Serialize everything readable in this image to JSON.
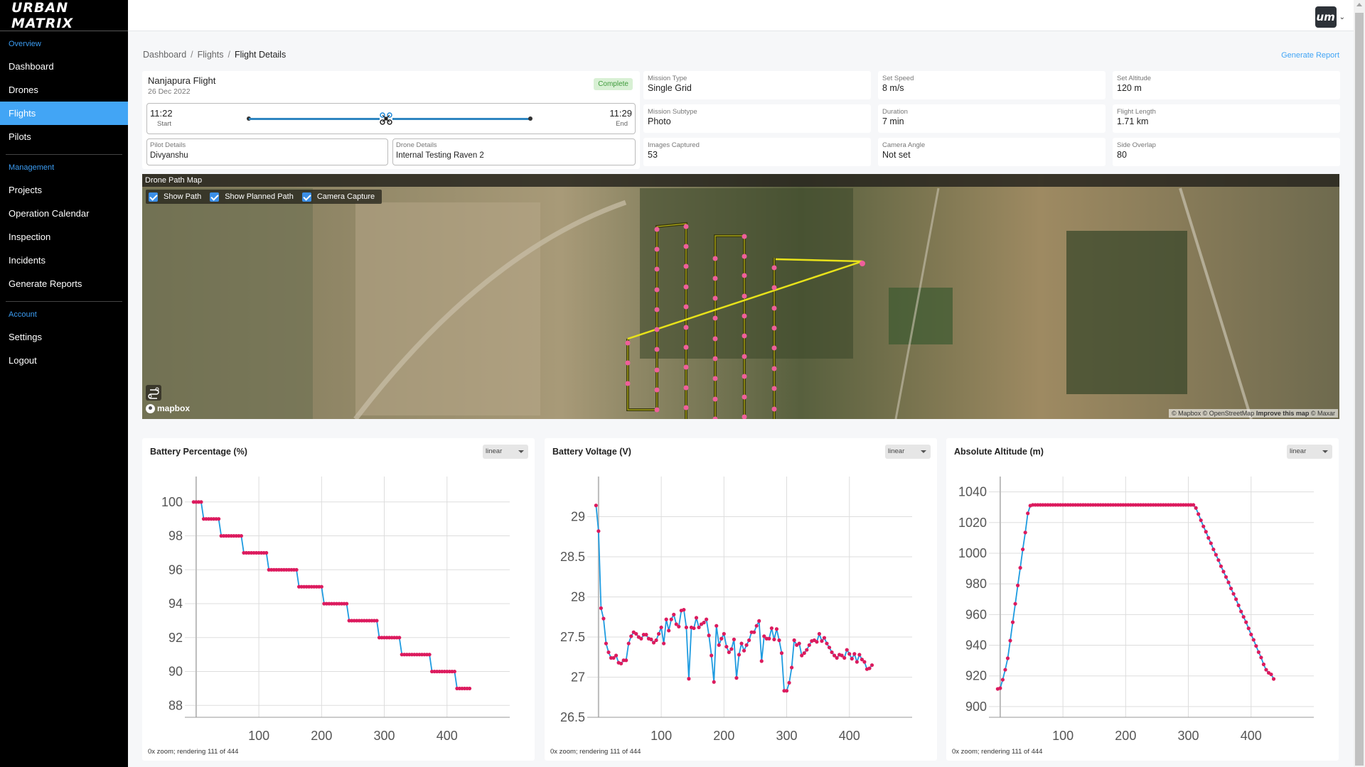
{
  "app": {
    "logo_text": "URBAN MATRIX",
    "avatar_text": "um"
  },
  "sidebar": {
    "sections": [
      {
        "title": "Overview",
        "items": [
          "Dashboard",
          "Drones",
          "Flights",
          "Pilots"
        ]
      },
      {
        "title": "Management",
        "items": [
          "Projects",
          "Operation Calendar",
          "Inspection",
          "Incidents",
          "Generate Reports"
        ]
      },
      {
        "title": "Account",
        "items": [
          "Settings",
          "Logout"
        ]
      }
    ],
    "active_item": "Flights"
  },
  "breadcrumb": {
    "items": [
      "Dashboard",
      "Flights"
    ],
    "current": "Flight Details",
    "separator": "/"
  },
  "generate_report_label": "Generate Report",
  "flight": {
    "name": "Nanjapura Flight",
    "date": "26 Dec 2022",
    "status": "Complete",
    "start_time": "11:22",
    "start_label": "Start",
    "end_time": "11:29",
    "end_label": "End",
    "pilot_label": "Pilot Details",
    "pilot": "Divyanshu",
    "drone_label": "Drone Details",
    "drone": "Internal Testing Raven 2"
  },
  "stats": [
    {
      "label": "Mission Type",
      "value": "Single Grid"
    },
    {
      "label": "Set Speed",
      "value": "8 m/s"
    },
    {
      "label": "Set Altitude",
      "value": "120 m"
    },
    {
      "label": "Mission Subtype",
      "value": "Photo"
    },
    {
      "label": "Duration",
      "value": "7 min"
    },
    {
      "label": "Flight Length",
      "value": "1.71 km"
    },
    {
      "label": "Images Captured",
      "value": "53"
    },
    {
      "label": "Camera Angle",
      "value": "Not set"
    },
    {
      "label": "Side Overlap",
      "value": "80"
    }
  ],
  "map": {
    "title": "Drone Path Map",
    "controls": [
      {
        "label": "Show Path",
        "checked": true
      },
      {
        "label": "Show Planned Path",
        "checked": true
      },
      {
        "label": "Camera Capture",
        "checked": true
      }
    ],
    "logo": "mapbox",
    "attribution": {
      "mapbox": "© Mapbox",
      "osm": "© OpenStreetMap",
      "improve": "Improve this map",
      "maxar": "© Maxar"
    },
    "colors": {
      "flown_path": "#e8e21a",
      "planned_path": "#3a3a10",
      "capture_point": "#ef5f9b"
    }
  },
  "chart_footer": "0x zoom; rendering 111 of 444",
  "chart_data": [
    {
      "type": "line",
      "title": "Battery Percentage (%)",
      "scale_option": "linear",
      "xlabel": "",
      "ylabel": "",
      "xlim": [
        -18,
        500
      ],
      "ylim": [
        87.3,
        101.5
      ],
      "xticks": [
        100,
        200,
        300,
        400
      ],
      "yticks": [
        88,
        90,
        92,
        94,
        96,
        98,
        100
      ],
      "grid": true,
      "colors": {
        "line": "#1e9be0",
        "marker": "#dc1b5e"
      },
      "steps": [
        {
          "value": 100,
          "x_from": -4,
          "x_to": 8
        },
        {
          "value": 99,
          "x_from": 12,
          "x_to": 36
        },
        {
          "value": 98,
          "x_from": 40,
          "x_to": 72
        },
        {
          "value": 97,
          "x_from": 76,
          "x_to": 112
        },
        {
          "value": 96,
          "x_from": 116,
          "x_to": 160
        },
        {
          "value": 95,
          "x_from": 164,
          "x_to": 200
        },
        {
          "value": 94,
          "x_from": 204,
          "x_to": 240
        },
        {
          "value": 93,
          "x_from": 244,
          "x_to": 288
        },
        {
          "value": 92,
          "x_from": 292,
          "x_to": 324
        },
        {
          "value": 91,
          "x_from": 328,
          "x_to": 372
        },
        {
          "value": 90,
          "x_from": 376,
          "x_to": 412
        },
        {
          "value": 89,
          "x_from": 416,
          "x_to": 436
        }
      ],
      "sample_step": 4
    },
    {
      "type": "line",
      "title": "Battery Voltage (V)",
      "scale_option": "linear",
      "xlabel": "",
      "ylabel": "",
      "xlim": [
        -18,
        500
      ],
      "ylim": [
        26.5,
        29.5
      ],
      "xticks": [
        100,
        200,
        300,
        400
      ],
      "yticks": [
        26.5,
        27,
        27.5,
        28,
        28.5,
        29
      ],
      "yticklabels": [
        "26.5",
        "27",
        "27.5",
        "28",
        "28.5",
        "29"
      ],
      "grid": true,
      "colors": {
        "line": "#1e9be0",
        "marker": "#dc1b5e"
      },
      "x_start": -4,
      "x_step": 4,
      "values": [
        29.14,
        28.82,
        27.86,
        27.73,
        27.42,
        27.31,
        27.24,
        27.24,
        27.27,
        27.18,
        27.17,
        27.21,
        27.21,
        27.42,
        27.51,
        27.56,
        27.54,
        27.5,
        27.48,
        27.53,
        27.53,
        27.48,
        27.47,
        27.43,
        27.46,
        27.54,
        27.62,
        27.42,
        27.72,
        27.58,
        27.72,
        27.78,
        27.66,
        27.63,
        27.83,
        27.84,
        27.62,
        26.98,
        27.62,
        27.61,
        27.74,
        27.62,
        27.66,
        27.68,
        27.72,
        27.52,
        27.27,
        26.94,
        27.64,
        27.4,
        27.48,
        27.54,
        27.38,
        27.31,
        27.35,
        27.47,
        26.99,
        27.28,
        27.42,
        27.33,
        27.4,
        27.46,
        27.56,
        27.56,
        27.64,
        27.7,
        27.2,
        27.51,
        27.48,
        27.48,
        27.61,
        27.47,
        27.6,
        27.46,
        27.3,
        26.83,
        26.83,
        26.93,
        27.12,
        27.46,
        27.4,
        27.42,
        27.27,
        27.3,
        27.34,
        27.4,
        27.45,
        27.46,
        27.44,
        27.54,
        27.45,
        27.49,
        27.42,
        27.37,
        27.31,
        27.27,
        27.24,
        27.28,
        27.27,
        27.24,
        27.34,
        27.29,
        27.23,
        27.29,
        27.19,
        27.28,
        27.22,
        27.19,
        27.1,
        27.11,
        27.15
      ]
    },
    {
      "type": "line",
      "title": "Absolute Altitude (m)",
      "scale_option": "linear",
      "xlabel": "",
      "ylabel": "",
      "xlim": [
        -18,
        500
      ],
      "ylim": [
        893,
        1050
      ],
      "xticks": [
        100,
        200,
        300,
        400
      ],
      "yticks": [
        900,
        920,
        940,
        960,
        980,
        1000,
        1020,
        1040
      ],
      "grid": true,
      "colors": {
        "line": "#1e9be0",
        "marker": "#dc1b5e"
      },
      "segments": [
        {
          "phase": "ascent",
          "points": [
            [
              -4,
              911.5
            ],
            [
              0,
              912
            ],
            [
              4,
              917.5
            ],
            [
              8,
              924
            ],
            [
              12,
              931.5
            ],
            [
              16,
              943
            ],
            [
              20,
              955
            ],
            [
              24,
              967
            ],
            [
              28,
              979
            ],
            [
              32,
              990.5
            ],
            [
              36,
              1002.5
            ],
            [
              40,
              1013.5
            ],
            [
              44,
              1026
            ],
            [
              48,
              1031
            ]
          ]
        },
        {
          "phase": "cruise",
          "x_from": 52,
          "x_to": 308,
          "value": 1031.5
        },
        {
          "phase": "descent",
          "points": [
            [
              312,
              1029.5
            ],
            [
              316,
              1025.5
            ],
            [
              320,
              1021.5
            ],
            [
              324,
              1017.5
            ],
            [
              328,
              1014
            ],
            [
              332,
              1010
            ],
            [
              336,
              1006.5
            ],
            [
              340,
              1002.5
            ],
            [
              344,
              999
            ],
            [
              348,
              995.5
            ],
            [
              352,
              991.5
            ],
            [
              356,
              988
            ],
            [
              360,
              984.5
            ],
            [
              364,
              981
            ],
            [
              368,
              977
            ],
            [
              372,
              973.5
            ],
            [
              376,
              970
            ],
            [
              380,
              966
            ],
            [
              384,
              962
            ],
            [
              388,
              958.5
            ],
            [
              392,
              955
            ],
            [
              396,
              951
            ],
            [
              400,
              947
            ],
            [
              404,
              943.5
            ],
            [
              408,
              939.5
            ],
            [
              412,
              935.5
            ],
            [
              416,
              932
            ],
            [
              420,
              927.5
            ],
            [
              424,
              924
            ],
            [
              428,
              922
            ],
            [
              432,
              921
            ],
            [
              436,
              918
            ]
          ]
        }
      ]
    }
  ]
}
